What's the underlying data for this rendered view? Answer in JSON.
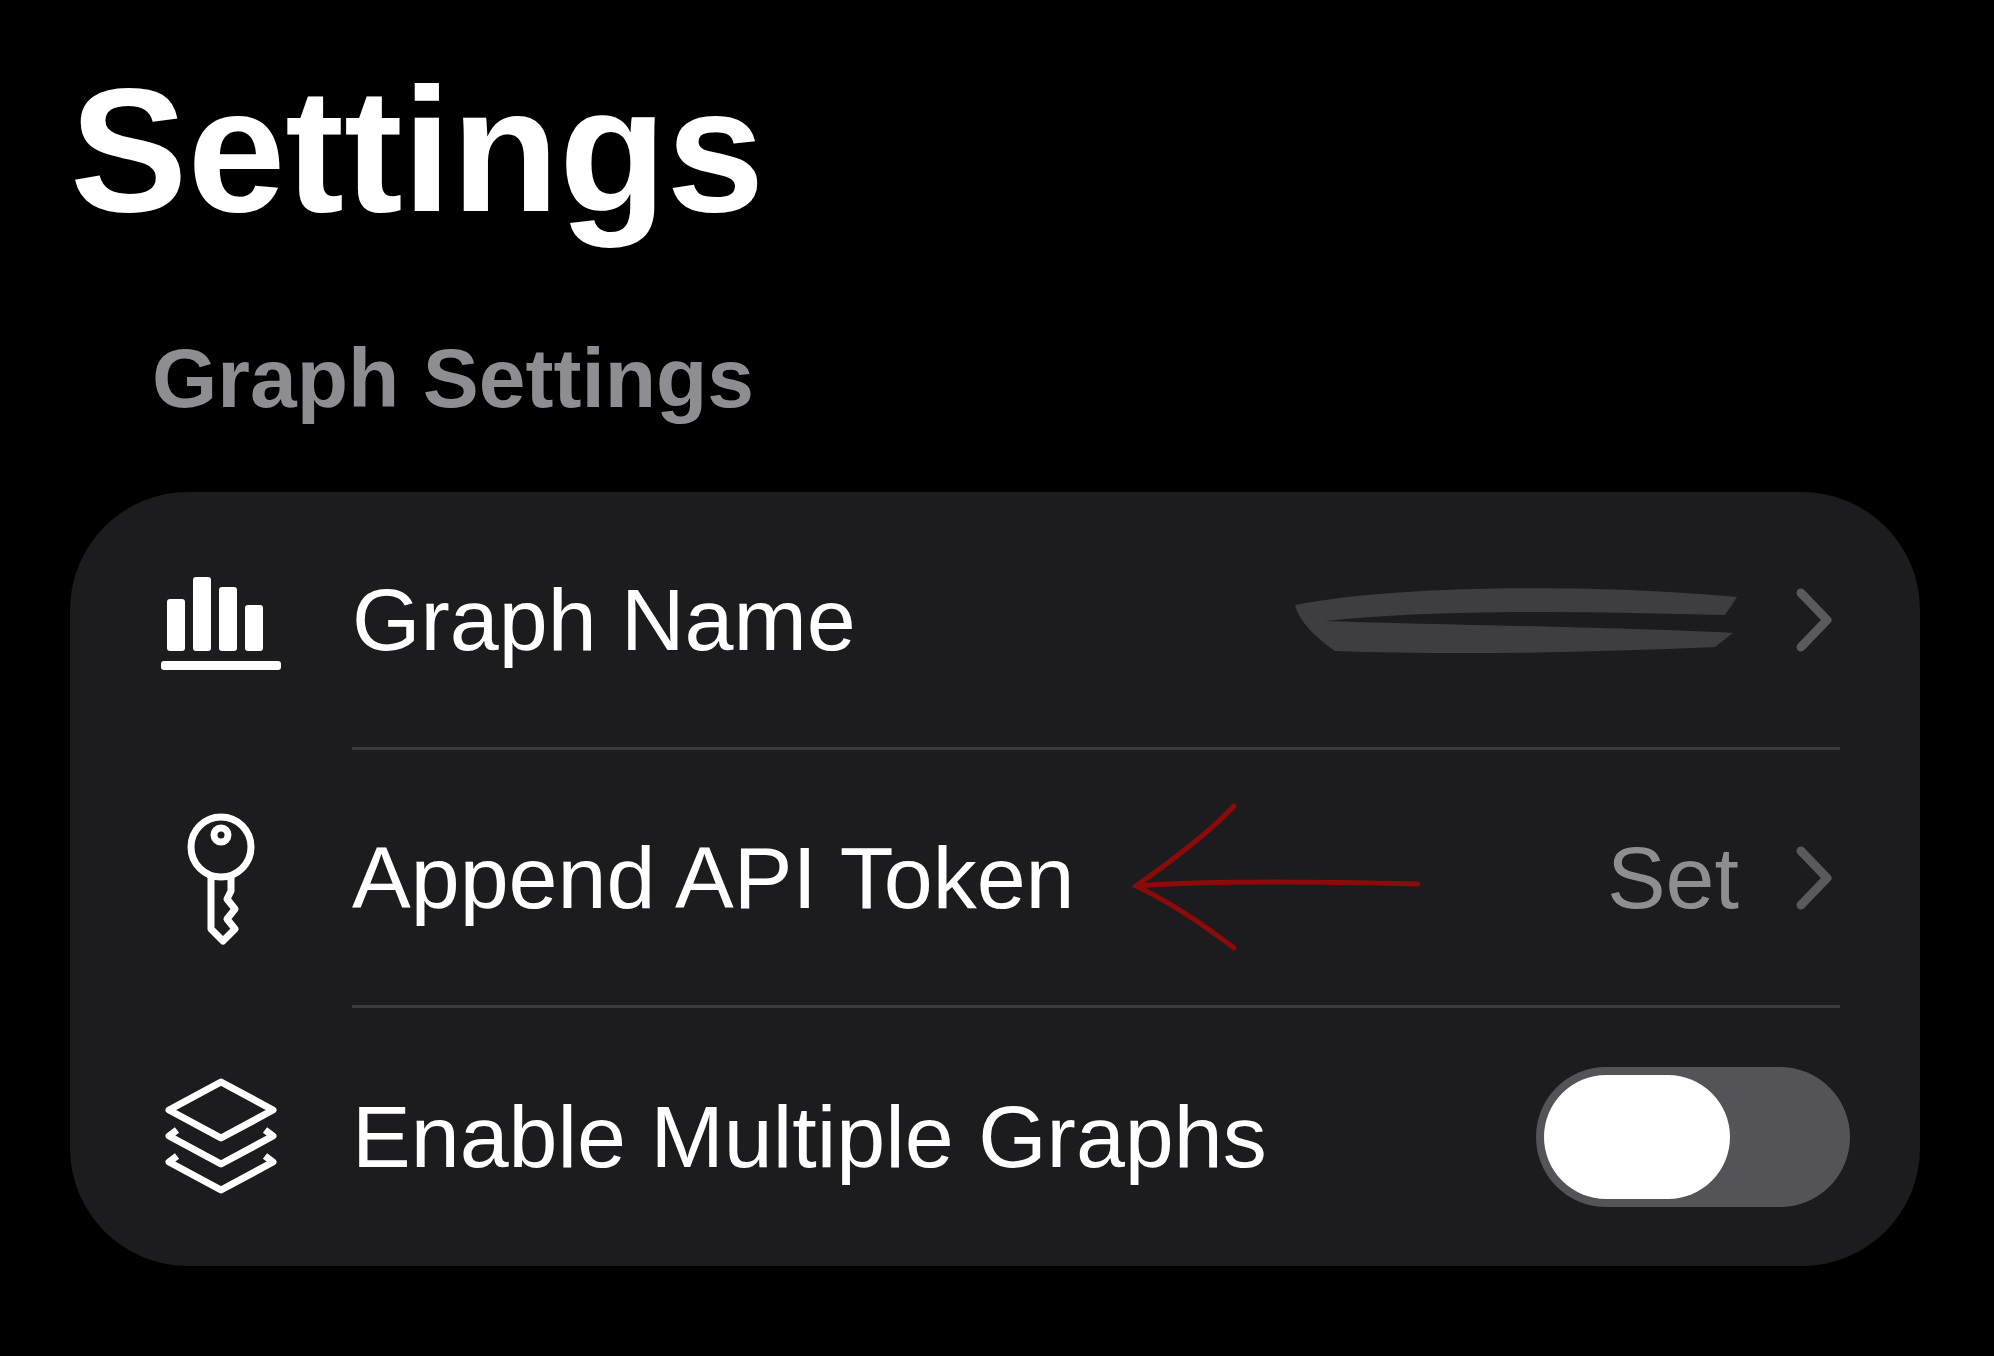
{
  "title": "Settings",
  "section": {
    "header": "Graph Settings",
    "rows": [
      {
        "kind": "redacted-link",
        "label": "Graph Name"
      },
      {
        "kind": "link",
        "label": "Append API Token",
        "value": "Set"
      },
      {
        "kind": "toggle",
        "label": "Enable Multiple Graphs",
        "on": false
      }
    ]
  }
}
